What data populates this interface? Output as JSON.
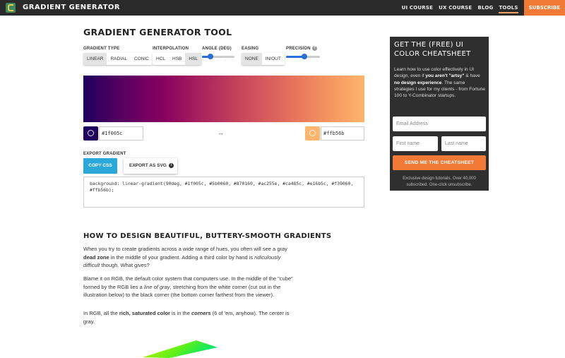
{
  "nav": {
    "brand": "GRADIENT GENERATOR",
    "links": [
      "UI COURSE",
      "UX COURSE",
      "BLOG",
      "TOOLS"
    ],
    "subscribe": "SUBSCRIBE",
    "colors": {
      "bar": "#2b2b2b",
      "subscribe": "#f07a36"
    }
  },
  "tool": {
    "title": "GRADIENT GENERATOR TOOL",
    "gradient_type": {
      "label": "GRADIENT TYPE",
      "options": [
        "LINEAR",
        "RADIAL",
        "CONIC"
      ],
      "selected": "LINEAR"
    },
    "interpolation": {
      "label": "INTERPOLATION",
      "options": [
        "HCL",
        "HSB",
        "HSL"
      ],
      "selected": "HSL"
    },
    "angle": {
      "label": "ANGLE (DEG)",
      "value_fraction": 0.25
    },
    "easing": {
      "label": "EASING",
      "options": [
        "NONE",
        "IN/OUT"
      ],
      "selected": "NONE"
    },
    "precision": {
      "label": "PRECISION",
      "value_fraction": 0.55,
      "help_icon": "question-icon"
    },
    "stops": [
      "#1f005c",
      "#5b0060",
      "#870160",
      "#ac255e",
      "#ca485c",
      "#e16b5c",
      "#f39060",
      "#ffb56b"
    ],
    "start_color": "#1f005c",
    "end_color": "#ffb56b",
    "start_icon": "palette-icon",
    "end_icon": "palette-icon",
    "swap_icon": "↔",
    "export": {
      "label": "EXPORT GRADIENT",
      "copy_css": "COPY CSS",
      "export_svg": "EXPORT AS SVG",
      "info_icon": "i"
    },
    "css_code": "background: linear-gradient(90deg, #1f005c, #5b0060, #870160, #ac255e, #ca485c, #e16b5c, #f39060, #ffb56b);"
  },
  "article": {
    "heading": "HOW TO DESIGN BEAUTIFUL, BUTTERY-SMOOTH GRADIENTS",
    "p1": [
      {
        "t": "When you try to create gradients across a wide range of hues, you often will see a gray "
      },
      {
        "t": "dead zone",
        "b": true
      },
      {
        "t": " in the middle of your gradient. Adding a third color by hand is "
      },
      {
        "t": "ridiculously difficult",
        "i": true
      },
      {
        "t": " though. What gives?"
      }
    ],
    "p2": [
      {
        "t": "Blame it on RGB, the default color system that computers use. In the middle of the \"cube\" formed by the RGB lies a "
      },
      {
        "t": "line of gray",
        "i": true
      },
      {
        "t": ", stretching from the white corner (cut out in the illustration below) to the black corner (the bottom corner farthest from the viewer)."
      }
    ],
    "p3": [
      {
        "t": "In RGB, all the "
      },
      {
        "t": "rich, saturated color",
        "b": true
      },
      {
        "t": " is in the "
      },
      {
        "t": "corners",
        "b": true,
        "i": true
      },
      {
        "t": " (6 of 'em, anyhow). The center is gray."
      }
    ]
  },
  "sidebar": {
    "title": "GET THE (FREE) UI COLOR CHEATSHEET",
    "body": [
      {
        "t": "Learn how to use color effectively in UI design, even if "
      },
      {
        "t": "you aren't \"artsy\"",
        "b": true
      },
      {
        "t": " & have "
      },
      {
        "t": "no design experience",
        "b": true
      },
      {
        "t": ". The same strategies I use for my clients - from Fortune 100 to Y-Combinator startups."
      }
    ],
    "email_placeholder": "Email Address",
    "first_placeholder": "First name",
    "last_placeholder": "Last name",
    "button": "SEND ME THE CHEATSHEET",
    "footnote": "Exclusive design tutorials. Over 40,000 subscribed. One-click unsubscribe."
  }
}
